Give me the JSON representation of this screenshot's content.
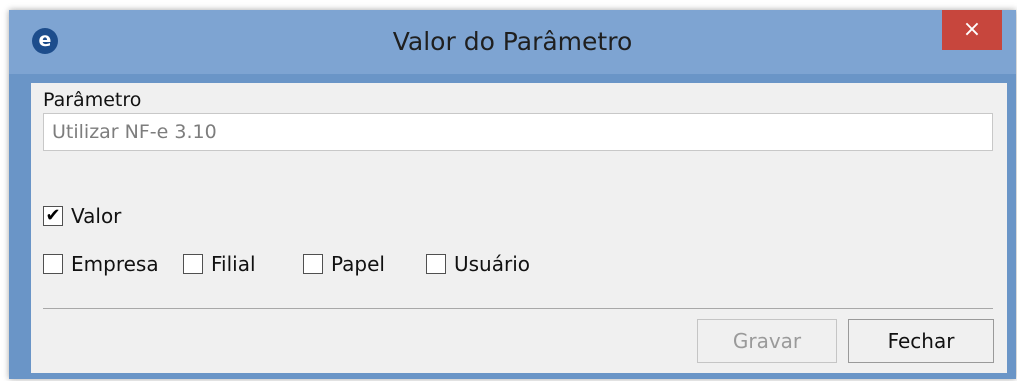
{
  "window": {
    "title": "Valor do Parâmetro",
    "close_glyph": "×",
    "app_icon_letter": "e"
  },
  "form": {
    "parametro_label": "Parâmetro",
    "parametro_value": "Utilizar NF-e 3.10",
    "valor": {
      "label": "Valor",
      "checked": true
    },
    "scope": [
      {
        "label": "Empresa",
        "checked": false
      },
      {
        "label": "Filial",
        "checked": false
      },
      {
        "label": "Papel",
        "checked": false
      },
      {
        "label": "Usuário",
        "checked": false
      }
    ]
  },
  "buttons": {
    "gravar": "Gravar",
    "fechar": "Fechar"
  },
  "check_glyph": "✔",
  "colors": {
    "titlebar": "#7ea4d2",
    "close": "#c7463d",
    "client": "#f0f0f0"
  }
}
